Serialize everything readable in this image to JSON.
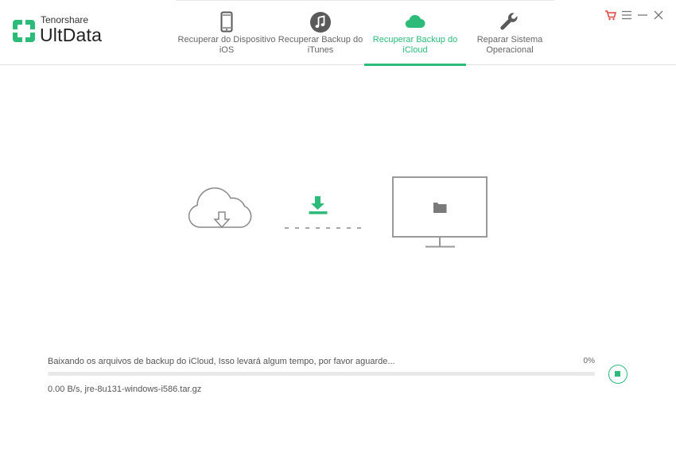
{
  "app": {
    "company": "Tenorshare",
    "product": "UltData",
    "accent_color": "#2dbb7a"
  },
  "nav": {
    "tabs": [
      {
        "label": "Recuperar do Dispositivo iOS",
        "icon": "phone-icon",
        "active": false
      },
      {
        "label": "Recuperar Backup do iTunes",
        "icon": "itunes-music-icon",
        "active": false
      },
      {
        "label": "Recuperar Backup do iCloud",
        "icon": "cloud-icon",
        "active": true
      },
      {
        "label": "Reparar Sistema Operacional",
        "icon": "wrench-icon",
        "active": false
      }
    ]
  },
  "window_controls": [
    {
      "name": "cart-icon",
      "color": "#e0443e"
    },
    {
      "name": "menu-icon"
    },
    {
      "name": "minimize-icon"
    },
    {
      "name": "close-icon"
    }
  ],
  "illustration": {
    "source_icon": "cloud-download-icon",
    "transfer_icon": "download-arrow-icon",
    "target_icon": "monitor-folder-icon"
  },
  "progress": {
    "status_text": "Baixando os arquivos de backup do iCloud, Isso levará algum tempo, por favor aguarde...",
    "percent_text": "0%",
    "percent_value": 0,
    "detail_text": "0.00 B/s, jre-8u131-windows-i586.tar.gz",
    "stop_icon": "stop-icon"
  }
}
